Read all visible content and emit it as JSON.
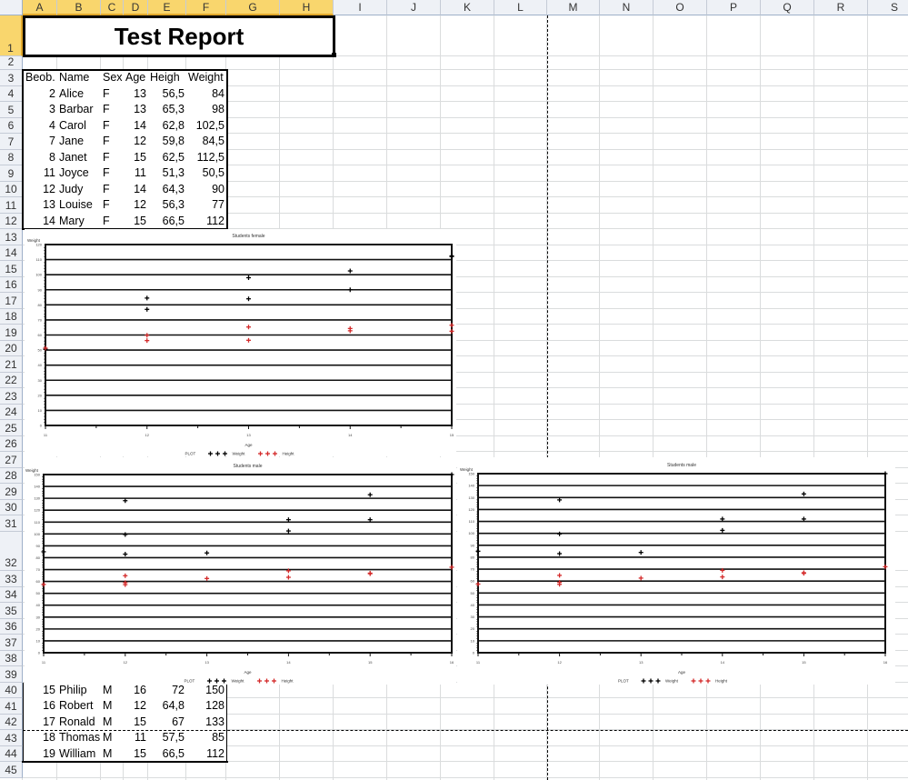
{
  "sheet": {
    "columns": [
      "A",
      "B",
      "C",
      "D",
      "E",
      "F",
      "G",
      "H",
      "I",
      "J",
      "K",
      "L",
      "M",
      "N",
      "O",
      "P",
      "Q",
      "R",
      "S"
    ],
    "row_count": 45,
    "selected_columns": [
      "A",
      "B",
      "C",
      "D",
      "E",
      "F",
      "G",
      "H"
    ],
    "selected_row": 1
  },
  "report": {
    "title": "Test Report"
  },
  "table": {
    "headers": [
      "Beob.",
      "Name",
      "Sex",
      "Age",
      "Heigh",
      "Weight"
    ],
    "rows_top": [
      [
        "2",
        "Alice",
        "F",
        "13",
        "56,5",
        "84"
      ],
      [
        "3",
        "Barbar",
        "F",
        "13",
        "65,3",
        "98"
      ],
      [
        "4",
        "Carol",
        "F",
        "14",
        "62,8",
        "102,5"
      ],
      [
        "7",
        "Jane",
        "F",
        "12",
        "59,8",
        "84,5"
      ],
      [
        "8",
        "Janet",
        "F",
        "15",
        "62,5",
        "112,5"
      ],
      [
        "11",
        "Joyce",
        "F",
        "11",
        "51,3",
        "50,5"
      ],
      [
        "12",
        "Judy",
        "F",
        "14",
        "64,3",
        "90"
      ],
      [
        "13",
        "Louise",
        "F",
        "12",
        "56,3",
        "77"
      ],
      [
        "14",
        "Mary",
        "F",
        "15",
        "66,5",
        "112"
      ]
    ],
    "rows_bottom": [
      [
        "15",
        "Philip",
        "M",
        "16",
        "72",
        "150"
      ],
      [
        "16",
        "Robert",
        "M",
        "12",
        "64,8",
        "128"
      ],
      [
        "17",
        "Ronald",
        "M",
        "15",
        "67",
        "133"
      ],
      [
        "18",
        "Thomas",
        "M",
        "11",
        "57,5",
        "85"
      ],
      [
        "19",
        "William",
        "M",
        "15",
        "66,5",
        "112"
      ]
    ]
  },
  "chart_data": [
    {
      "type": "scatter",
      "title": "Students female",
      "xlabel": "Age",
      "ylabel": "Weight",
      "xlim": [
        11,
        15
      ],
      "ylim": [
        0,
        120
      ],
      "ystep": 10,
      "xticks": [
        11,
        12,
        13,
        14,
        15
      ],
      "grid": true,
      "legend_title": "PLOT",
      "legend_placement": "bottom",
      "series": [
        {
          "name": "Weight",
          "color": "#000000",
          "points": [
            [
              11,
              50.5
            ],
            [
              12,
              84.5
            ],
            [
              12,
              77
            ],
            [
              13,
              98
            ],
            [
              13,
              84
            ],
            [
              14,
              102.5
            ],
            [
              14,
              90
            ],
            [
              15,
              112.5
            ],
            [
              15,
              112
            ]
          ]
        },
        {
          "name": "Height",
          "color": "#d42a2a",
          "points": [
            [
              11,
              51.3
            ],
            [
              12,
              59.8
            ],
            [
              12,
              56.3
            ],
            [
              13,
              65.3
            ],
            [
              13,
              56.5
            ],
            [
              14,
              64.3
            ],
            [
              14,
              62.8
            ],
            [
              15,
              66.5
            ],
            [
              15,
              62.5
            ]
          ]
        }
      ]
    },
    {
      "type": "scatter",
      "title": "Students male",
      "xlabel": "Age",
      "ylabel": "Weight",
      "xlim": [
        11,
        16
      ],
      "ylim": [
        0,
        150
      ],
      "ystep": 10,
      "xticks": [
        11,
        12,
        13,
        14,
        15,
        16
      ],
      "grid": true,
      "legend_title": "PLOT",
      "legend_placement": "bottom",
      "series": [
        {
          "name": "Weight",
          "color": "#000000",
          "points": [
            [
              11,
              85
            ],
            [
              12,
              128
            ],
            [
              12,
              99.5
            ],
            [
              12,
              83
            ],
            [
              13,
              84
            ],
            [
              14,
              112
            ],
            [
              14,
              102.5
            ],
            [
              15,
              133
            ],
            [
              15,
              112
            ],
            [
              16,
              150
            ]
          ]
        },
        {
          "name": "Height",
          "color": "#d42a2a",
          "points": [
            [
              11,
              57.5
            ],
            [
              12,
              64.8
            ],
            [
              12,
              59
            ],
            [
              12,
              57.3
            ],
            [
              13,
              62.5
            ],
            [
              14,
              69
            ],
            [
              14,
              63.5
            ],
            [
              15,
              67
            ],
            [
              15,
              66.5
            ],
            [
              16,
              72
            ]
          ]
        }
      ]
    },
    {
      "type": "scatter",
      "title": "Students male",
      "xlabel": "Age",
      "ylabel": "Weight",
      "xlim": [
        11,
        16
      ],
      "ylim": [
        0,
        150
      ],
      "ystep": 10,
      "xticks": [
        11,
        12,
        13,
        14,
        15,
        16
      ],
      "grid": true,
      "legend_title": "PLOT",
      "legend_placement": "bottom",
      "series": [
        {
          "name": "Weight",
          "color": "#000000",
          "points": [
            [
              11,
              85
            ],
            [
              12,
              128
            ],
            [
              12,
              99.5
            ],
            [
              12,
              83
            ],
            [
              13,
              84
            ],
            [
              14,
              112
            ],
            [
              14,
              102.5
            ],
            [
              15,
              133
            ],
            [
              15,
              112
            ],
            [
              16,
              150
            ]
          ]
        },
        {
          "name": "Height",
          "color": "#d42a2a",
          "points": [
            [
              11,
              57.5
            ],
            [
              12,
              64.8
            ],
            [
              12,
              59
            ],
            [
              12,
              57.3
            ],
            [
              13,
              62.5
            ],
            [
              14,
              69
            ],
            [
              14,
              63.5
            ],
            [
              15,
              67
            ],
            [
              15,
              66.5
            ],
            [
              16,
              72
            ]
          ]
        }
      ]
    }
  ]
}
